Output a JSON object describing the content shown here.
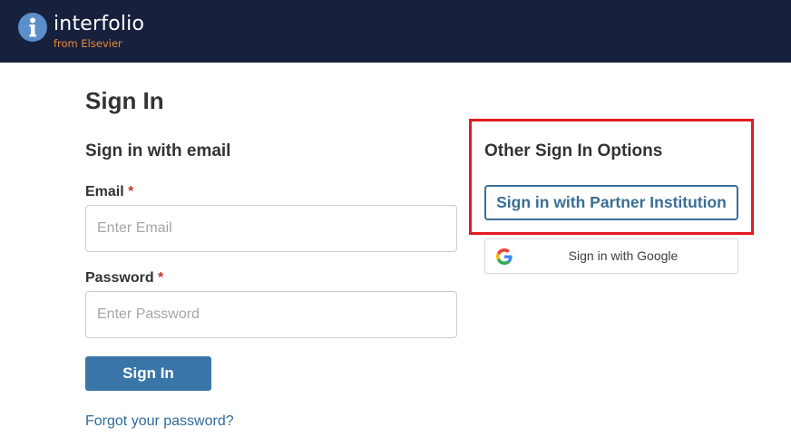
{
  "header": {
    "brand": "interfolio",
    "brand_sub": "from Elsevier",
    "logo_icon": "info-i-circle-icon",
    "background_color": "#17213d",
    "accent_color": "#e98a3c"
  },
  "page": {
    "title": "Sign In"
  },
  "email_form": {
    "section_title": "Sign in with email",
    "email_label": "Email",
    "email_required": "*",
    "email_placeholder": "Enter Email",
    "email_value": "",
    "password_label": "Password",
    "password_required": "*",
    "password_placeholder": "Enter Password",
    "password_value": "",
    "submit_label": "Sign In",
    "forgot_link": "Forgot your password?",
    "button_color": "#3a75a8"
  },
  "other_options": {
    "section_title": "Other Sign In Options",
    "partner_label": "Sign in with Partner Institution",
    "google_label": "Sign in with Google",
    "google_icon": "google-g-icon",
    "highlight_color": "#e11b22"
  }
}
